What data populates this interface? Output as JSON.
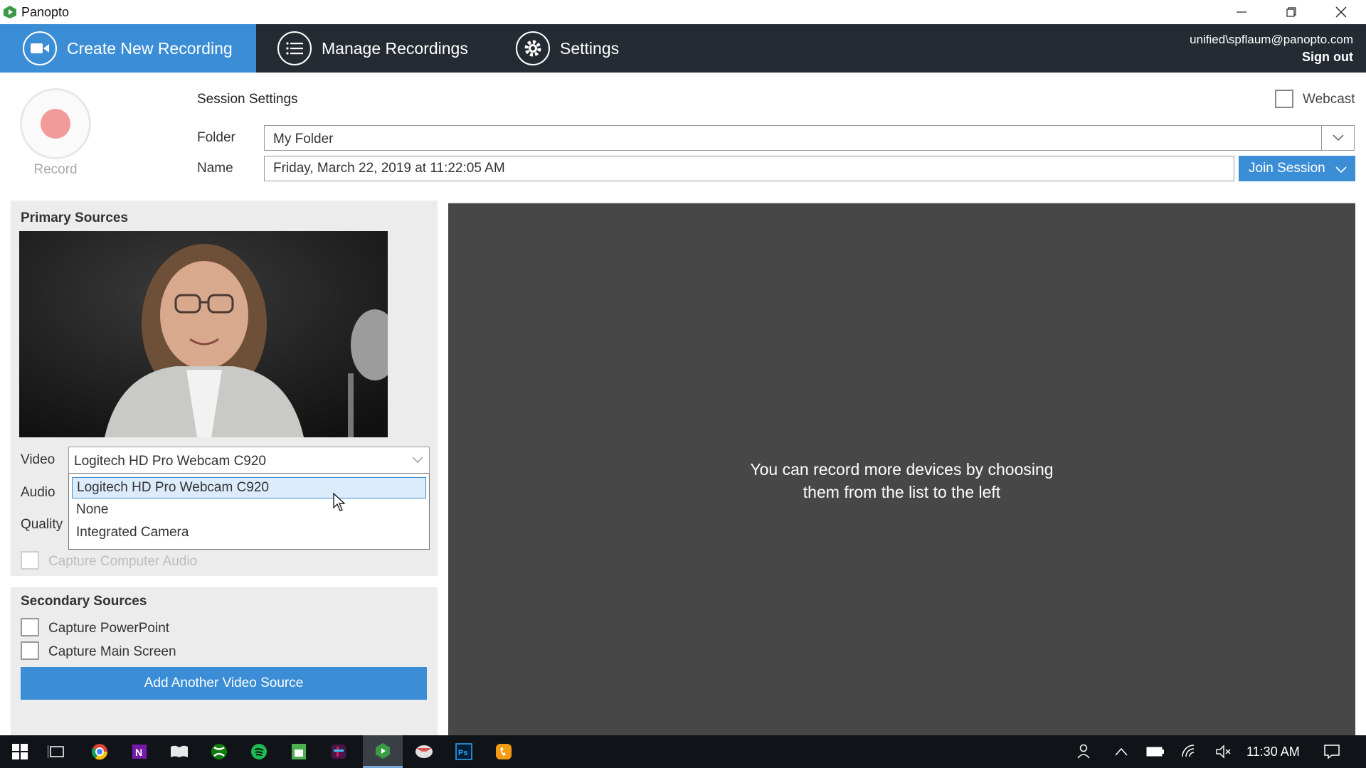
{
  "window": {
    "title": "Panopto"
  },
  "nav": {
    "create_label": "Create New Recording",
    "manage_label": "Manage Recordings",
    "settings_label": "Settings",
    "user": "unified\\spflaum@panopto.com",
    "sign_out": "Sign out"
  },
  "record": {
    "label": "Record"
  },
  "session": {
    "title": "Session Settings",
    "webcast_label": "Webcast",
    "folder_label": "Folder",
    "folder_value": "My Folder",
    "name_label": "Name",
    "name_value": "Friday, March 22, 2019 at 11:22:05 AM",
    "join_label": "Join Session"
  },
  "primary": {
    "title": "Primary Sources",
    "video_label": "Video",
    "video_value": "Logitech HD Pro Webcam C920",
    "audio_label": "Audio",
    "quality_label": "Quality",
    "video_options": [
      "Logitech HD Pro Webcam C920",
      "None",
      "Integrated Camera"
    ],
    "capture_audio_label": "Capture Computer Audio"
  },
  "secondary": {
    "title": "Secondary Sources",
    "ppt_label": "Capture PowerPoint",
    "screen_label": "Capture Main Screen",
    "add_label": "Add Another Video Source"
  },
  "preview": {
    "line1": "You can record more devices by choosing",
    "line2": "them from the list to the left"
  },
  "taskbar": {
    "clock": "11:30 AM"
  },
  "colors": {
    "accent": "#3b8ed6",
    "nav_bg": "#252b33",
    "preview_bg": "#474747",
    "record_dot": "#f39b9b"
  }
}
